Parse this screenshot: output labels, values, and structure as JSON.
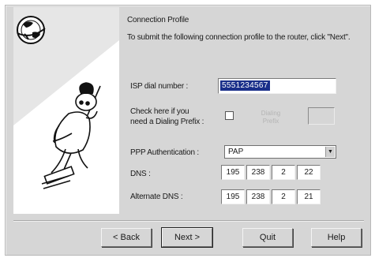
{
  "dialog": {
    "title": "Connection Profile",
    "intro": "To submit the following connection profile to the router, click \"Next\"."
  },
  "form": {
    "isp_label": "ISP dial number :",
    "isp_value": "5551234567",
    "prefix_check_label_line1": "Check here if you",
    "prefix_check_label_line2": "need a Dialing Prefix :",
    "prefix_field_label": "Dialing Prefix",
    "auth_label": "PPP Authentication :",
    "auth_value": "PAP",
    "dns_label": "DNS :",
    "dns_octets": [
      "195",
      "238",
      "2",
      "22"
    ],
    "alt_dns_label": "Alternate DNS :",
    "alt_dns_octets": [
      "195",
      "238",
      "2",
      "21"
    ]
  },
  "buttons": {
    "back": "< Back",
    "next": "Next >",
    "quit": "Quit",
    "help": "Help"
  }
}
